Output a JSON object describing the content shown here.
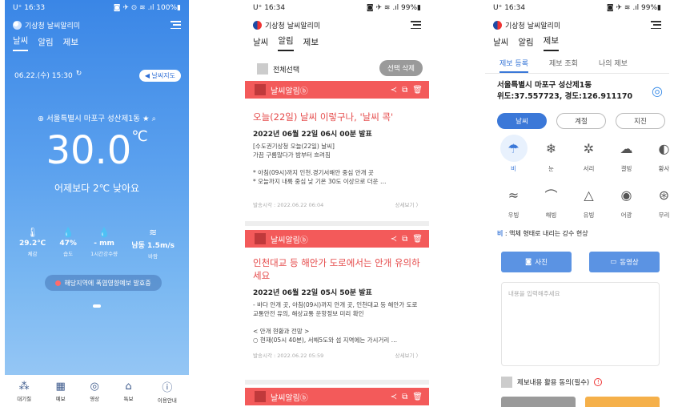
{
  "phone1": {
    "status": {
      "time": "U⁺ 16:33",
      "right": "◙ ✈ ⊙ ≋ .ıl 100%▮"
    },
    "app_title": "기상청 날씨알리미",
    "tabs": [
      "날씨",
      "알림",
      "제보"
    ],
    "date": "06.22.(수) 15:30",
    "map_button": "날씨지도",
    "location": "서울특별시 마포구 성산제1동",
    "temp": "30.0",
    "temp_unit": "℃",
    "compare": "어제보다 2℃ 낮아요",
    "stats": [
      {
        "icon": "🌡",
        "value": "29.2℃",
        "label": "체감"
      },
      {
        "icon": "💧",
        "value": "47%",
        "label": "습도"
      },
      {
        "icon": "💧",
        "value": "- mm",
        "label": "1시간강수량"
      },
      {
        "icon": "≋",
        "value": "남동 1.5m/s",
        "label": "바람"
      }
    ],
    "alert": "해당지역에 폭염영향예보 발효중",
    "nav": [
      {
        "icon": "⁂",
        "label": "대기질"
      },
      {
        "icon": "▦",
        "label": "예보"
      },
      {
        "icon": "◎",
        "label": "영상"
      },
      {
        "icon": "⌂",
        "label": "특보"
      },
      {
        "icon": "ⓘ",
        "label": "이용안내"
      }
    ]
  },
  "phone2": {
    "status": {
      "time": "U⁺ 16:34",
      "right": "◙ ✈ ≋ .ıl 99%▮"
    },
    "app_title": "기상청 날씨알리미",
    "tabs": [
      "날씨",
      "알림",
      "제보"
    ],
    "select_all": "전체선택",
    "delete_selected": "선택 삭제",
    "card_header": "날씨알림ⓑ",
    "cards": [
      {
        "title": "오늘(22일) 날씨 이렇구나, '날씨 콕'",
        "subtitle": "2022년 06월 22일 06시 00분 발표",
        "body": "[수도권기상청 오늘(22일) 날씨]\n가끔 구름많다가 밤부터 흐려짐\n\n* 아침(09시)까지 인천.경기서해안 중심 안개 곳\n* 오늘까지 내륙 중심 낮 기온 30도 이상으로 더운 …",
        "time": "발송시각 : 2022.06.22 06:04",
        "more": "상세보기 〉"
      },
      {
        "title": "인천대교 등 해안가 도로에서는 안개 유의하세요",
        "subtitle": "2022년 06월 22일 05시 50분 발표",
        "body": "- 바다 안개 곳, 아침(09시)까지 안개 곳, 인천대교 등 해안가 도로 교통안전 유의, 해상교통 운항정보 미리 확인\n\n< 안개 현황과 전망 >\n○ 현재(05시 40분), 서해5도와 섬 지역에는 가시거리 …",
        "time": "발송시각 : 2022.06.22 05:59",
        "more": "상세보기 〉"
      }
    ]
  },
  "phone3": {
    "status": {
      "time": "U⁺ 16:34",
      "right": "◙ ✈ ≋ .ıl 99%▮"
    },
    "app_title": "기상청 날씨알리미",
    "tabs": [
      "날씨",
      "알림",
      "제보"
    ],
    "subtabs": [
      "제보 등록",
      "제보 조회",
      "나의 제보"
    ],
    "address": "서울특별시 마포구 성산제1동",
    "coords": "위도:37.557723, 경도:126.911170",
    "categories": [
      "날씨",
      "계절",
      "지진"
    ],
    "weather_types": [
      {
        "icon": "☂",
        "label": "비"
      },
      {
        "icon": "❄",
        "label": "눈"
      },
      {
        "icon": "✲",
        "label": "서리"
      },
      {
        "icon": "☁",
        "label": "결빙"
      },
      {
        "icon": "◐",
        "label": "황사"
      },
      {
        "icon": "≈",
        "label": "우빙"
      },
      {
        "icon": "⌒",
        "label": "해빙"
      },
      {
        "icon": "△",
        "label": "유빙"
      },
      {
        "icon": "◉",
        "label": "어광"
      },
      {
        "icon": "⊛",
        "label": "무리"
      }
    ],
    "desc_term": "비",
    "desc_text": " : 액체 형태로 내리는 강수 현상",
    "photo": "사진",
    "video": "동영상",
    "textarea_placeholder": "내용을 입력해주세요",
    "agree": "제보내용 활용 동의(필수)",
    "colors": {
      "accent": "#3b78d8",
      "alert": "#f35a5a"
    }
  }
}
